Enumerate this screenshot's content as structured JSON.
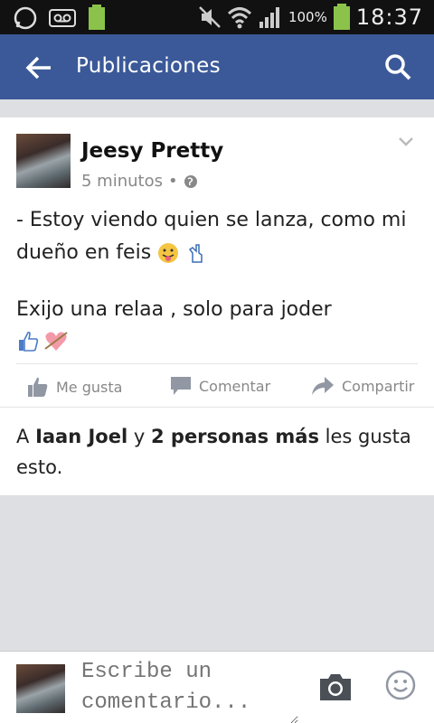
{
  "status_bar": {
    "battery_pct": "100%",
    "time": "18:37"
  },
  "app_bar": {
    "title": "Publicaciones"
  },
  "post": {
    "author": "Jeesy Pretty",
    "time_ago": "5 minutos",
    "separator": "•",
    "text_line1": "- Estoy viendo quien se lanza, como mi dueño en feis",
    "text_line2": "Exijo una relaa , solo para joder",
    "actions": {
      "like": "Me gusta",
      "comment": "Comentar",
      "share": "Compartir"
    },
    "likes": {
      "prefix": "A",
      "name": "Iaan Joel",
      "conj": "y",
      "others": "2 personas más",
      "suffix": "les gusta esto."
    }
  },
  "comment_bar": {
    "placeholder": "Escribe un comentario..."
  },
  "colors": {
    "brand": "#3b5998",
    "status_bar": "#111111",
    "background": "#dddfe2"
  }
}
